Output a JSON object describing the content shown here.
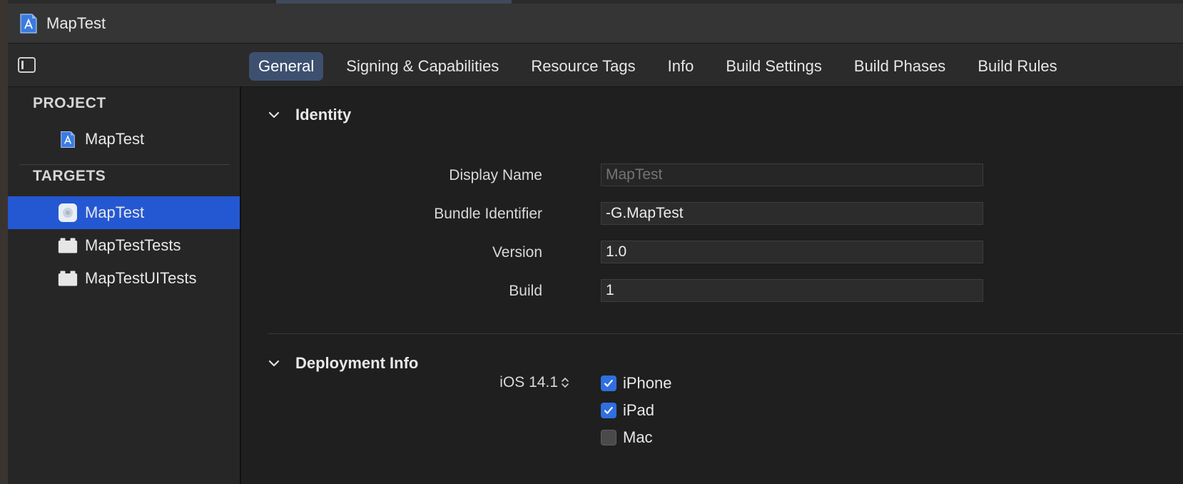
{
  "window": {
    "title": "MapTest"
  },
  "tabs": [
    {
      "label": "General",
      "active": true
    },
    {
      "label": "Signing & Capabilities"
    },
    {
      "label": "Resource Tags"
    },
    {
      "label": "Info"
    },
    {
      "label": "Build Settings"
    },
    {
      "label": "Build Phases"
    },
    {
      "label": "Build Rules"
    }
  ],
  "sidebar": {
    "project_header": "PROJECT",
    "project_item": "MapTest",
    "targets_header": "TARGETS",
    "targets": [
      {
        "label": "MapTest",
        "selected": true,
        "icon": "app-target-icon"
      },
      {
        "label": "MapTestTests",
        "icon": "test-bundle-icon"
      },
      {
        "label": "MapTestUITests",
        "icon": "test-bundle-icon"
      }
    ]
  },
  "identity": {
    "title": "Identity",
    "display_name_label": "Display Name",
    "display_name_placeholder": "MapTest",
    "bundle_id_label": "Bundle Identifier",
    "bundle_id_value": "-G.MapTest",
    "version_label": "Version",
    "version_value": "1.0",
    "build_label": "Build",
    "build_value": "1"
  },
  "deployment": {
    "title": "Deployment Info",
    "ios_version": "iOS 14.1",
    "devices": [
      {
        "label": "iPhone",
        "checked": true
      },
      {
        "label": "iPad",
        "checked": true
      },
      {
        "label": "Mac",
        "checked": false
      }
    ]
  },
  "colors": {
    "accent_selection": "#2458d2",
    "active_tab": "#3d5070",
    "checkbox_on": "#2f6fe0"
  }
}
